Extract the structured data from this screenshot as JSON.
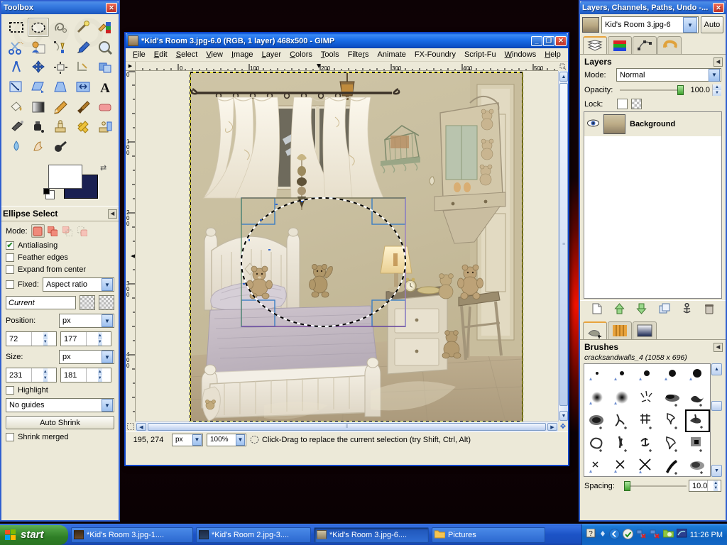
{
  "toolbox": {
    "title": "Toolbox",
    "close_label": "✕",
    "tools": [
      {
        "name": "rect-select-tool",
        "label": "Rectangle Select"
      },
      {
        "name": "ellipse-select-tool",
        "label": "Ellipse Select",
        "active": true
      },
      {
        "name": "free-select-tool",
        "label": "Free Select"
      },
      {
        "name": "fuzzy-select-tool",
        "label": "Fuzzy Select"
      },
      {
        "name": "select-by-color-tool",
        "label": "Select by Color"
      },
      {
        "name": "scissors-select-tool",
        "label": "Scissors Select"
      },
      {
        "name": "foreground-select-tool",
        "label": "Foreground Select"
      },
      {
        "name": "paths-tool",
        "label": "Paths"
      },
      {
        "name": "color-picker-tool",
        "label": "Color Picker"
      },
      {
        "name": "zoom-tool",
        "label": "Zoom"
      },
      {
        "name": "measure-tool",
        "label": "Measure"
      },
      {
        "name": "move-tool",
        "label": "Move"
      },
      {
        "name": "align-tool",
        "label": "Alignment"
      },
      {
        "name": "crop-tool",
        "label": "Crop"
      },
      {
        "name": "rotate-tool",
        "label": "Rotate"
      },
      {
        "name": "scale-tool",
        "label": "Scale"
      },
      {
        "name": "shear-tool",
        "label": "Shear"
      },
      {
        "name": "perspective-tool",
        "label": "Perspective"
      },
      {
        "name": "flip-tool",
        "label": "Flip"
      },
      {
        "name": "text-tool",
        "label": "Text"
      },
      {
        "name": "bucket-fill-tool",
        "label": "Bucket Fill"
      },
      {
        "name": "gradient-tool",
        "label": "Blend"
      },
      {
        "name": "pencil-tool",
        "label": "Pencil"
      },
      {
        "name": "paintbrush-tool",
        "label": "Paintbrush"
      },
      {
        "name": "eraser-tool",
        "label": "Eraser"
      },
      {
        "name": "airbrush-tool",
        "label": "Airbrush"
      },
      {
        "name": "ink-tool",
        "label": "Ink"
      },
      {
        "name": "clone-tool",
        "label": "Clone"
      },
      {
        "name": "heal-tool",
        "label": "Heal"
      },
      {
        "name": "perspective-clone-tool",
        "label": "Perspective Clone"
      },
      {
        "name": "blur-sharpen-tool",
        "label": "Blur / Sharpen"
      },
      {
        "name": "smudge-tool",
        "label": "Smudge"
      },
      {
        "name": "dodge-burn-tool",
        "label": "Dodge / Burn"
      }
    ],
    "colors": {
      "foreground": "#ffffff",
      "background": "#1a2052"
    }
  },
  "tool_options": {
    "title": "Ellipse Select",
    "mode_label": "Mode:",
    "modes": [
      "replace",
      "add",
      "subtract",
      "intersect"
    ],
    "selected_mode": 0,
    "antialiasing": {
      "label": "Antialiasing",
      "checked": true
    },
    "feather_edges": {
      "label": "Feather edges",
      "checked": false
    },
    "expand_from_center": {
      "label": "Expand from center",
      "checked": false
    },
    "fixed": {
      "label": "Fixed:",
      "checked": false,
      "value": "Aspect ratio"
    },
    "aspect_value": "Current",
    "position": {
      "label": "Position:",
      "unit": "px",
      "x": "72",
      "y": "177"
    },
    "size": {
      "label": "Size:",
      "unit": "px",
      "w": "231",
      "h": "181"
    },
    "highlight": {
      "label": "Highlight",
      "checked": false
    },
    "guides": "No guides",
    "auto_shrink": "Auto Shrink",
    "shrink_merged": {
      "label": "Shrink merged",
      "checked": false
    }
  },
  "image_window": {
    "title": "*Kid's Room 3.jpg-6.0 (RGB, 1 layer) 468x500 - GIMP",
    "minimize_label": "_",
    "maximize_label": "❐",
    "close_label": "✕",
    "menus": [
      "File",
      "Edit",
      "Select",
      "View",
      "Image",
      "Layer",
      "Colors",
      "Tools",
      "Filters",
      "Animate",
      "FX-Foundry",
      "Script-Fu",
      "Windows",
      "Help"
    ],
    "ruler_h_ticks": [
      "0",
      "100",
      "200",
      "300",
      "400",
      "500"
    ],
    "ruler_v_ticks": [
      "0",
      "100",
      "200",
      "300",
      "400"
    ],
    "status": {
      "pointer": "195, 274",
      "unit": "px",
      "zoom": "100%",
      "message": "Click-Drag to replace the current selection (try Shift, Ctrl, Alt)"
    }
  },
  "dock": {
    "title": "Layers, Channels, Paths, Undo -...",
    "close_label": "✕",
    "image_name": "Kid's Room 3.jpg-6",
    "auto_label": "Auto",
    "tabs": [
      {
        "name": "tab-layers",
        "label": "Layers",
        "active": true
      },
      {
        "name": "tab-channels",
        "label": "Channels"
      },
      {
        "name": "tab-paths",
        "label": "Paths"
      },
      {
        "name": "tab-undo",
        "label": "Undo History"
      }
    ],
    "layers_panel": {
      "title": "Layers",
      "mode_label": "Mode:",
      "mode_value": "Normal",
      "opacity_label": "Opacity:",
      "opacity_value": "100.0",
      "lock_label": "Lock:",
      "layers": [
        {
          "name": "Background",
          "visible": true
        }
      ]
    },
    "brushes_panel": {
      "title": "Brushes",
      "selected_brush": "cracksandwalls_4 (1058 x 696)",
      "spacing_label": "Spacing:",
      "spacing_value": "10.0"
    }
  },
  "taskbar": {
    "start_label": "start",
    "items": [
      {
        "label": "*Kid's Room 3.jpg-1....",
        "active": false
      },
      {
        "label": "*Kid's Room 2.jpg-3....",
        "active": false
      },
      {
        "label": "*Kid's Room 3.jpg-6....",
        "active": true
      },
      {
        "label": "Pictures",
        "active": false,
        "folder": true
      }
    ],
    "clock": "11:26 PM"
  },
  "colors": {
    "titlebar_blue": "#0b52cc",
    "panel_beige": "#ece9d8",
    "accent_orange": "#e8a33d",
    "taskbar_blue": "#1c53c6",
    "start_green": "#2f7f26"
  }
}
